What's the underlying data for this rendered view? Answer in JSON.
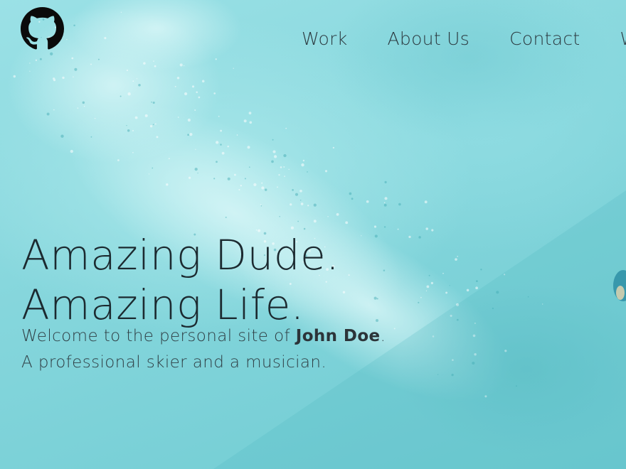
{
  "colors": {
    "background": "#8fdce2",
    "text": "#1c2a30",
    "logo": "#0b0b0b"
  },
  "logo": {
    "icon": "github-icon"
  },
  "nav": {
    "items": [
      {
        "label": "Work"
      },
      {
        "label": "About Us"
      },
      {
        "label": "Contact"
      },
      {
        "label": "Wh"
      }
    ]
  },
  "hero": {
    "headline_line1": "Amazing Dude.",
    "headline_line2": "Amazing Life.",
    "intro_prefix": "Welcome to the personal site of ",
    "intro_name": "John Doe",
    "intro_suffix": ".",
    "intro_line2": "A professional skier and a musician."
  }
}
